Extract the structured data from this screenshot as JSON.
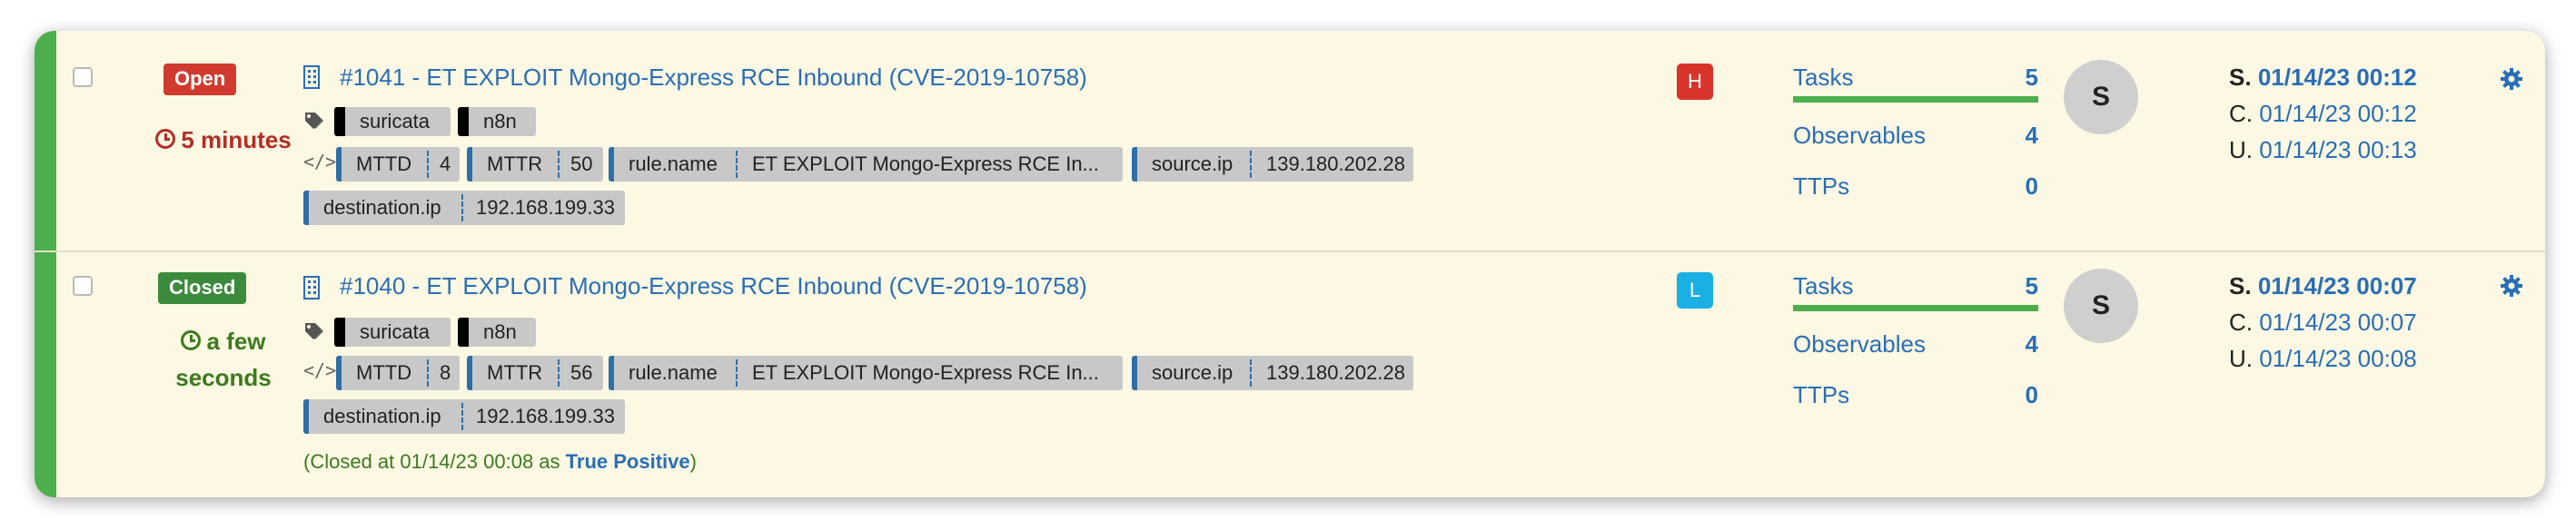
{
  "colors": {
    "accent": "#2a6eb5",
    "open": "#d03a2f",
    "closed": "#3c8a3c",
    "sev_high": "#d9342b",
    "sev_low": "#1ab0e3",
    "tasks_bar": "#4cae4c",
    "row_bg": "#fcf8e3"
  },
  "cases": [
    {
      "status": "Open",
      "age": "5 minutes",
      "title": "#1041 - ET EXPLOIT Mongo-Express RCE Inbound (CVE-2019-10758)",
      "tags": [
        "suricata",
        "n8n"
      ],
      "fields": [
        {
          "key": "MTTD",
          "value": "4"
        },
        {
          "key": "MTTR",
          "value": "50"
        },
        {
          "key": "rule.name",
          "value": "ET EXPLOIT Mongo-Express RCE In..."
        },
        {
          "key": "source.ip",
          "value": "139.180.202.28"
        },
        {
          "key": "destination.ip",
          "value": "192.168.199.33"
        }
      ],
      "severity": "H",
      "metrics": {
        "tasks_label": "Tasks",
        "tasks": "5",
        "observables_label": "Observables",
        "observables": "4",
        "ttps_label": "TTPs",
        "ttps": "0"
      },
      "assignee": "S",
      "dates": {
        "started_prefix": "S.",
        "started": "01/14/23 00:12",
        "created_prefix": "C.",
        "created": "01/14/23 00:12",
        "updated_prefix": "U.",
        "updated": "01/14/23 00:13"
      }
    },
    {
      "status": "Closed",
      "age_line1": "a few",
      "age_line2": "seconds",
      "title": "#1040 - ET EXPLOIT Mongo-Express RCE Inbound (CVE-2019-10758)",
      "tags": [
        "suricata",
        "n8n"
      ],
      "fields": [
        {
          "key": "MTTD",
          "value": "8"
        },
        {
          "key": "MTTR",
          "value": "56"
        },
        {
          "key": "rule.name",
          "value": "ET EXPLOIT Mongo-Express RCE In..."
        },
        {
          "key": "source.ip",
          "value": "139.180.202.28"
        },
        {
          "key": "destination.ip",
          "value": "192.168.199.33"
        }
      ],
      "closed_note_prefix": "(Closed at 01/14/23 00:08 as ",
      "closed_resolution": "True Positive",
      "closed_note_suffix": ")",
      "severity": "L",
      "metrics": {
        "tasks_label": "Tasks",
        "tasks": "5",
        "observables_label": "Observables",
        "observables": "4",
        "ttps_label": "TTPs",
        "ttps": "0"
      },
      "assignee": "S",
      "dates": {
        "started_prefix": "S.",
        "started": "01/14/23 00:07",
        "created_prefix": "C.",
        "created": "01/14/23 00:07",
        "updated_prefix": "U.",
        "updated": "01/14/23 00:08"
      }
    }
  ]
}
